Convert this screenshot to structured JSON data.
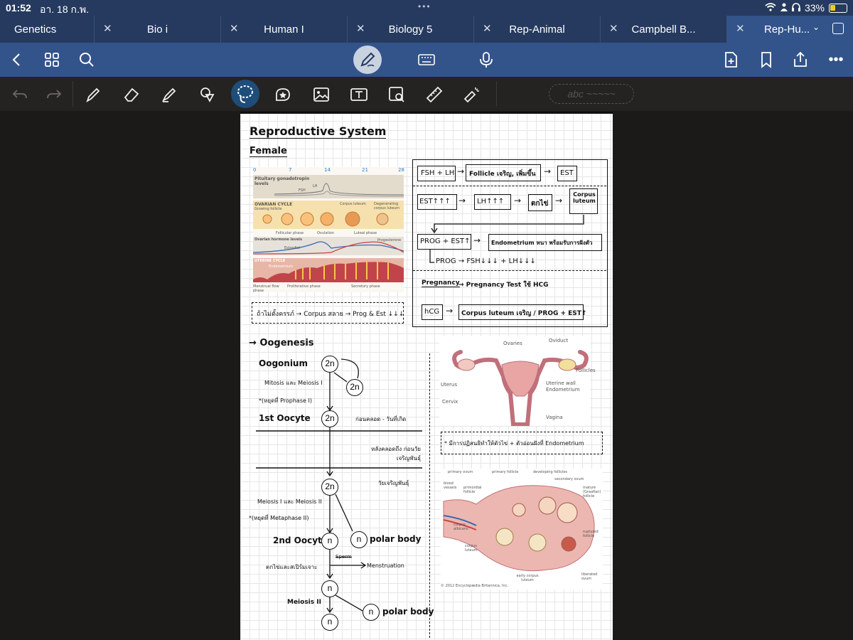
{
  "status": {
    "time": "01:52",
    "date": "อา. 18 ก.พ.",
    "battery": "33%",
    "battery_level": 0.33
  },
  "tabs": [
    {
      "label": "Genetics"
    },
    {
      "label": "Bio i"
    },
    {
      "label": "Human I"
    },
    {
      "label": "Biology 5"
    },
    {
      "label": "Rep-Animal"
    },
    {
      "label": "Campbell B..."
    },
    {
      "label": "Rep-Hu..."
    }
  ],
  "toolbar": {
    "text_placeholder": "abc ~~~~~"
  },
  "note": {
    "title": "Reproductive System",
    "subtitle": "Female",
    "figure1": {
      "ticks": [
        "0",
        "7",
        "14",
        "21",
        "28"
      ],
      "row1_title": "Pituitary gonadotropin levels",
      "fsh": "FSH",
      "lh": "LH",
      "row2_title": "OVARIAN CYCLE",
      "growing": "Growing follicle",
      "corpus_luteum": "Corpus luteum",
      "degenerating": "Degenerating corpus luteum",
      "follicular": "Follicular phase",
      "ovulation": "Ovulation",
      "luteal": "Luteal phase",
      "row3_title": "Ovarian hormone levels",
      "estradiol": "Estradiol",
      "progesterone": "Progesterone",
      "row4_title": "UTERINE CYCLE",
      "endometrium": "Endometrium",
      "menstrual": "Menstrual flow phase",
      "proliferative": "Proliferative phase",
      "secretory": "Secretory phase"
    },
    "note_no_pregnancy": "ถ้าไม่ตั้งครรภ์ → Corpus สลาย → Prog & Est ↓↓↓",
    "flow": {
      "fsh_lh": "FSH + LH",
      "follicle": "Follicle เจริญ, เพิ่มขึ้น",
      "est": "EST",
      "est_up": "EST↑↑↑",
      "lh_up": "LH↑↑↑",
      "ovulate": "ตกไข่",
      "corpus": "Corpus luteum",
      "prog_est": "PROG + EST↑",
      "endometrium": "Endometrium หนา พร้อมรับการฝังตัว",
      "prog_down": "PROG → FSH↓↓↓ + LH↓↓↓",
      "pregnancy": "Pregnancy",
      "pregnancy_test": "→ Pregnancy Test ใช้ HCG",
      "hcg": "hCG",
      "hcg_result": "Corpus luteum เจริญ / PROG + EST↑"
    },
    "oogenesis": {
      "title": "→ Oogenesis",
      "oogonium": "Oogonium",
      "mitosis": "Mitosis และ Meiosis I",
      "prophase": "*(หยุดที่ Prophase I)",
      "oocyte1": "1st Oocyte",
      "before_birth": "ก่อนคลอด - วันที่เกิด",
      "after_birth": "หลังคลอดถึง ก่อนวัยเจริญพันธุ์",
      "puberty": "วัยเจริญพันธุ์",
      "meiosis12": "Meiosis I และ Meiosis II",
      "metaphase": "*(หยุดที่ Metaphase II)",
      "oocyte2": "2nd Oocyte",
      "polar1": "polar body",
      "menstruation": "Menstruation",
      "sperm": "Sperm",
      "ovulate_no": "ตกไข่และสเปิร์มเจาะ",
      "meiosis2": "Meiosis II",
      "polar2": "polar body",
      "two_n": "2n",
      "n": "n"
    },
    "figure2": {
      "ovaries": "Ovaries",
      "oviduct": "Oviduct",
      "follicles": "Follicles",
      "uterus": "Uterus",
      "uterine_wall": "Uterine wall",
      "endometrium": "Endometrium",
      "cervix": "Cervix",
      "vagina": "Vagina"
    },
    "note_hormone": "* มีการปฏิสนธิทำให้ตัวไข่ + ตัวอ่อนฝังที่ Endometrium",
    "figure3": {
      "primary_oocyte": "primary ovum",
      "primary_follicle": "primary follicle",
      "developing": "developing follicles",
      "secondary": "secondary ovum",
      "mature": "mature (Graafian) follicle",
      "blood": "blood vessels",
      "primordial": "primordial follicle",
      "albicans": "corpus albicans",
      "luteum": "corpus luteum",
      "ruptured": "ruptured follicle",
      "early": "early corpus luteum",
      "liberated": "liberated ovum",
      "copyright": "© 2012 Encyclopædia Britannica, Inc."
    }
  }
}
